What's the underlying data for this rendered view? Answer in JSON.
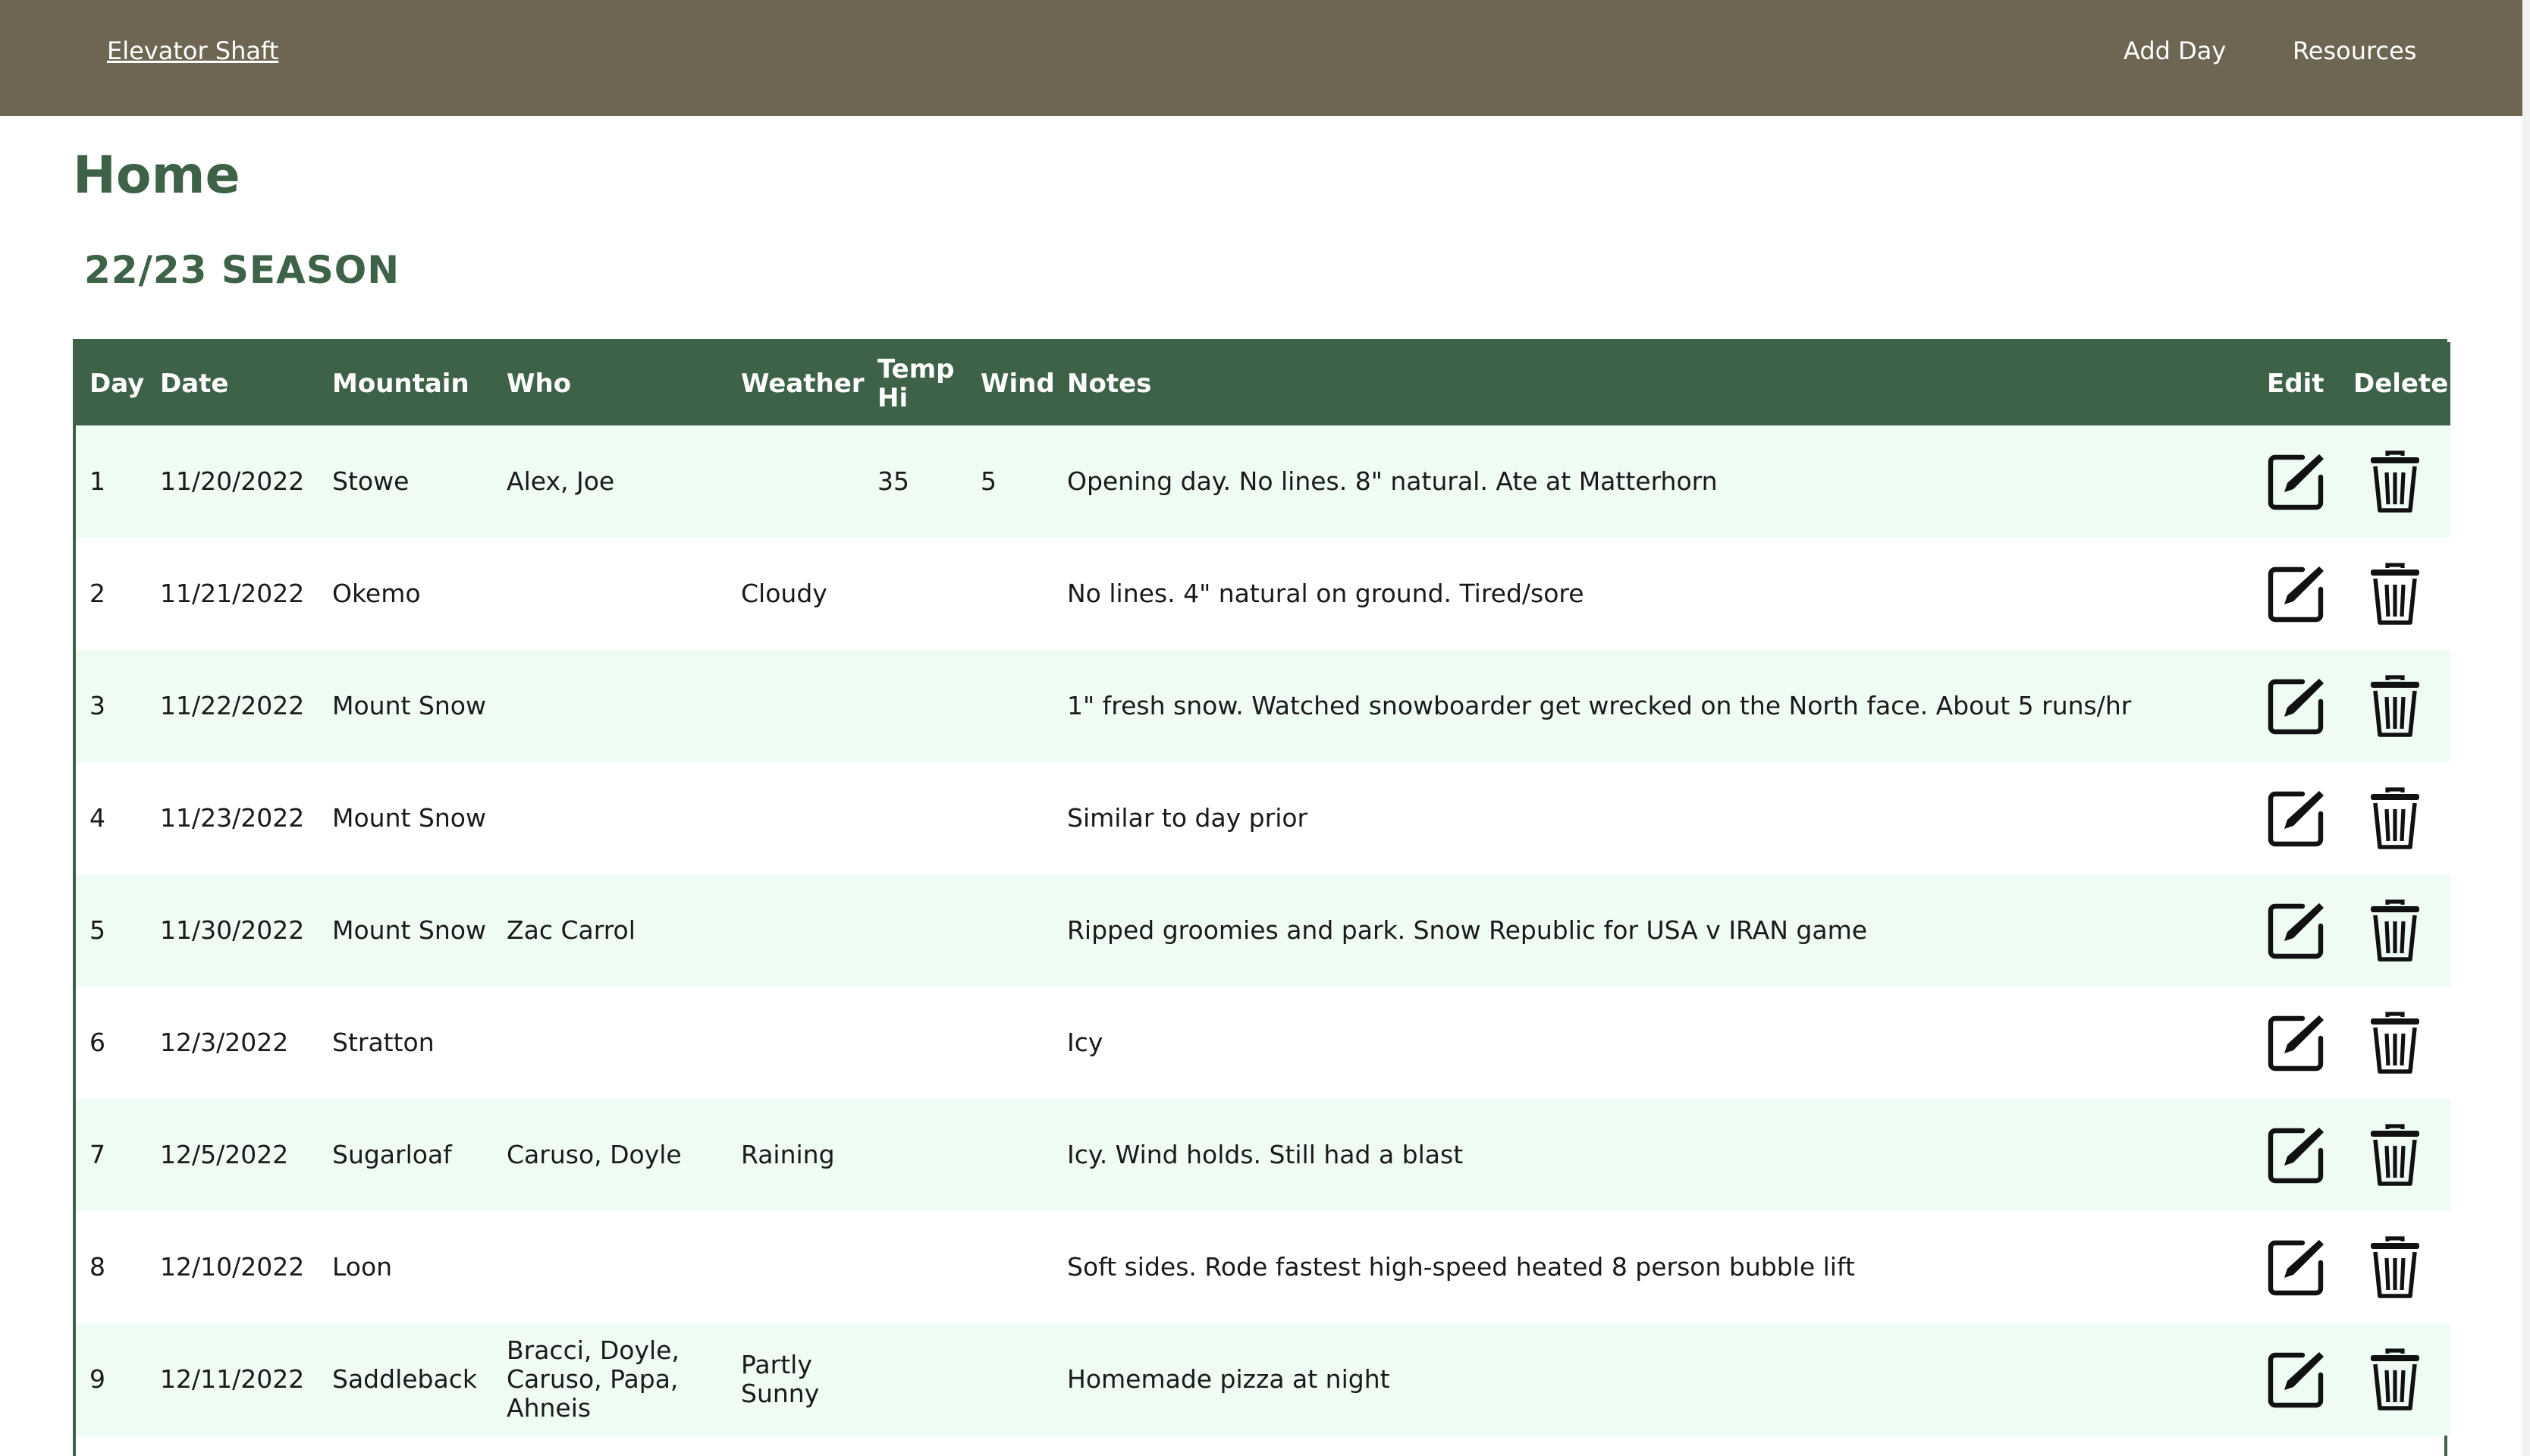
{
  "nav": {
    "brand": "Elevator Shaft",
    "links": [
      "Add Day",
      "Resources"
    ]
  },
  "page": {
    "title": "Home",
    "season": "22/23 SEASON"
  },
  "table": {
    "headers": {
      "day": "Day",
      "date": "Date",
      "mountain": "Mountain",
      "who": "Who",
      "weather": "Weather",
      "temp_line1": "Temp",
      "temp_line2": "Hi",
      "wind": "Wind",
      "notes": "Notes",
      "edit": "Edit",
      "delete": "Delete"
    },
    "rows": [
      {
        "day": "1",
        "date": "11/20/2022",
        "mountain": "Stowe",
        "who": "Alex, Joe",
        "weather": "",
        "temp": "35",
        "wind": "5",
        "notes": "Opening day. No lines. 8\" natural. Ate at Matterhorn"
      },
      {
        "day": "2",
        "date": "11/21/2022",
        "mountain": "Okemo",
        "who": "",
        "weather": "Cloudy",
        "temp": "",
        "wind": "",
        "notes": "No lines. 4\" natural on ground. Tired/sore"
      },
      {
        "day": "3",
        "date": "11/22/2022",
        "mountain": "Mount Snow",
        "who": "",
        "weather": "",
        "temp": "",
        "wind": "",
        "notes": "1\" fresh snow. Watched snowboarder get wrecked on the North face. About 5 runs/hr"
      },
      {
        "day": "4",
        "date": "11/23/2022",
        "mountain": "Mount Snow",
        "who": "",
        "weather": "",
        "temp": "",
        "wind": "",
        "notes": "Similar to day prior"
      },
      {
        "day": "5",
        "date": "11/30/2022",
        "mountain": "Mount Snow",
        "who": "Zac Carrol",
        "weather": "",
        "temp": "",
        "wind": "",
        "notes": "Ripped groomies and park. Snow Republic for USA v IRAN game"
      },
      {
        "day": "6",
        "date": "12/3/2022",
        "mountain": "Stratton",
        "who": "",
        "weather": "",
        "temp": "",
        "wind": "",
        "notes": "Icy"
      },
      {
        "day": "7",
        "date": "12/5/2022",
        "mountain": "Sugarloaf",
        "who": "Caruso, Doyle",
        "weather": "Raining",
        "temp": "",
        "wind": "",
        "notes": "Icy. Wind holds. Still had a blast"
      },
      {
        "day": "8",
        "date": "12/10/2022",
        "mountain": "Loon",
        "who": "",
        "weather": "",
        "temp": "",
        "wind": "",
        "notes": "Soft sides. Rode fastest high-speed heated 8 person bubble lift"
      },
      {
        "day": "9",
        "date": "12/11/2022",
        "mountain": "Saddleback",
        "who": "Bracci, Doyle, Caruso, Papa, Ahneis",
        "weather": "Partly Sunny",
        "temp": "",
        "wind": "",
        "notes": "Homemade pizza at night"
      }
    ]
  },
  "icons": {
    "edit": "edit-icon",
    "delete": "trash-icon"
  },
  "colors": {
    "navbar": "#6e6652",
    "accent_green": "#3d6247",
    "row_alt": "#eefcf4"
  }
}
